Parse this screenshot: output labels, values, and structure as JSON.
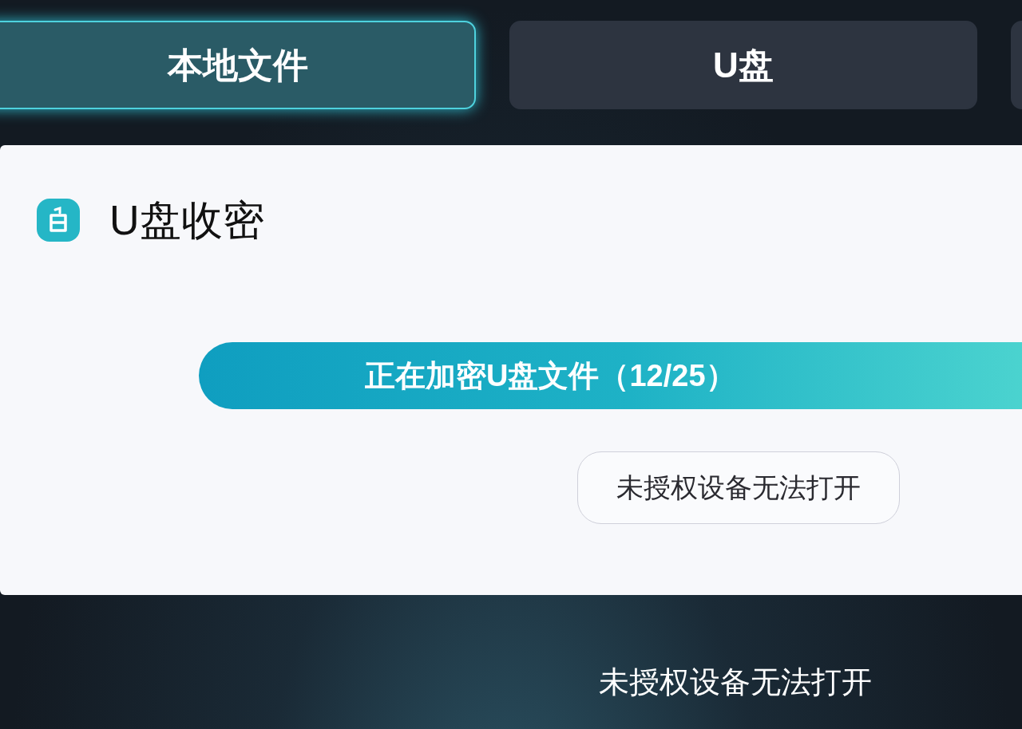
{
  "tabs": [
    {
      "label": "本地文件",
      "selected": true
    },
    {
      "label": "U盘",
      "selected": false
    },
    {
      "selected": false
    }
  ],
  "panel": {
    "title": "U盘收密",
    "status_banner": "正在加密U盘文件（12/25）",
    "notice": "未授权设备无法打开"
  },
  "caption": "未授权设备无法打开"
}
